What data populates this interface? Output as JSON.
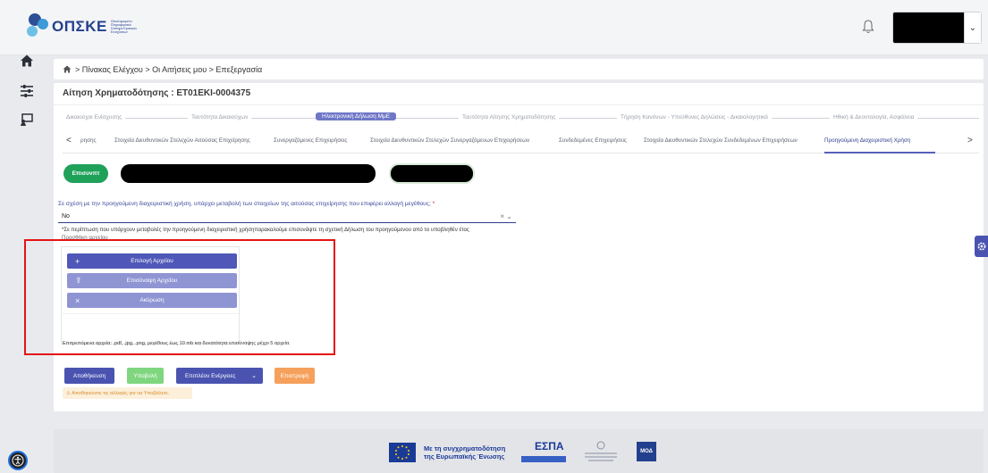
{
  "header": {
    "logo_text": "ΟΠΣΚΕ",
    "logo_subtext": "Ολοκληρωμένο Πληροφοριακό Σύστημα Κρατικών Ενισχύσεων",
    "bell_icon": "bell-icon",
    "user_caret": "⌄"
  },
  "sidebar": {
    "icons": [
      "home-icon",
      "sliders-icon",
      "presentation-icon"
    ]
  },
  "breadcrumb": {
    "text": "> Πίνακας Ελέγχου > Οι Αιτήσεις μου > Επεξεργασία"
  },
  "main": {
    "title": "Αίτηση Χρηματοδότησης : ΕΤ01ΕΚΙ-0004375",
    "steps": [
      "Δικαιούχοι Ενίσχυσης",
      "Ταυτότητα Δικαιούχων",
      "Ηλεκτρονική Δήλωση ΜμΕ",
      "Ταυτότητα Αίτησης Χρηματοδότησης",
      "Τήρηση Κανόνων - Υπεύθυνες Δηλώσεις - Δικαιολογητικά",
      "Ηθική & Δεοντολογία, Ασφάλεια"
    ],
    "subtabs": [
      "ρησης",
      "Στοιχεία Διευθυντικών Στελεχών Αιτούσας Επιχείρησης",
      "Συνεργαζόμενες Επιχειρήσεις",
      "Στοιχεία Διευθυντικών Στελεχών Συνεργαζόμενων Επιχειρήσεων",
      "Συνδεδεμένες Επιχειρήσεις",
      "Στοιχεία Διευθυντικών Στελεχών Συνδεδεμένων Επιχειρήσεων",
      "Προηγούμενη Διαχειριστική Χρήση"
    ],
    "tab_prev": "<",
    "tab_next": ">",
    "green_pill": "Επισυνπτ",
    "question": "Σε σχέση με την προηγούμενη διαχειριστική χρήση, υπάρχει μεταβολή των στοιχείων της αιτούσας επιχείρησης που επιφέρει αλλαγή μεγέθους;",
    "question_req": " *",
    "select_value": "Νο",
    "select_icons": "× ⌄",
    "hint": "*Σε περίπτωση που υπάρχουν μεταβολές την προηγούμενη διαχειριστική χρήσηπαρακαλούμε επισυνάψτε τη σχετική Δήλωση του προηγούμενου από το υποβληθέν έτος",
    "attach_label": "Προσθήκη αρχείου",
    "upload": {
      "choose": "Επιλογή Αρχείου",
      "attach": "Επισύναψη Αρχείου",
      "cancel": "Ακύρωση",
      "choose_icon": "+",
      "attach_icon": "⇪",
      "cancel_icon": "×"
    },
    "allowed": "Επιτρεπόμενα αρχεία: .pdf, .jpg, .png, μεγέθους έως 10 mb και δυνατότητα επισύναψης μέχρι 5 αρχεία.",
    "actions": {
      "save": "Αποθήκευση",
      "submit": "Υποβολή",
      "more": "Επιπλέον Ενέργειες",
      "more_caret": "⌄",
      "back": "Επιστροφή"
    },
    "warning": "⚠ Αποθηκεύστε τις αλλαγές για να Υποβάλετε."
  },
  "footer": {
    "eu_text_1": "Με τη συγχρηματοδότηση",
    "eu_text_2": "της Ευρωπαϊκής Ένωσης",
    "espa": "ΕΣΠΑ",
    "moda": "ΜΟΔ"
  },
  "colors": {
    "primary": "#4a54b0",
    "green": "#20a15a",
    "orange": "#f5a05b",
    "highlight": "#e41414"
  }
}
